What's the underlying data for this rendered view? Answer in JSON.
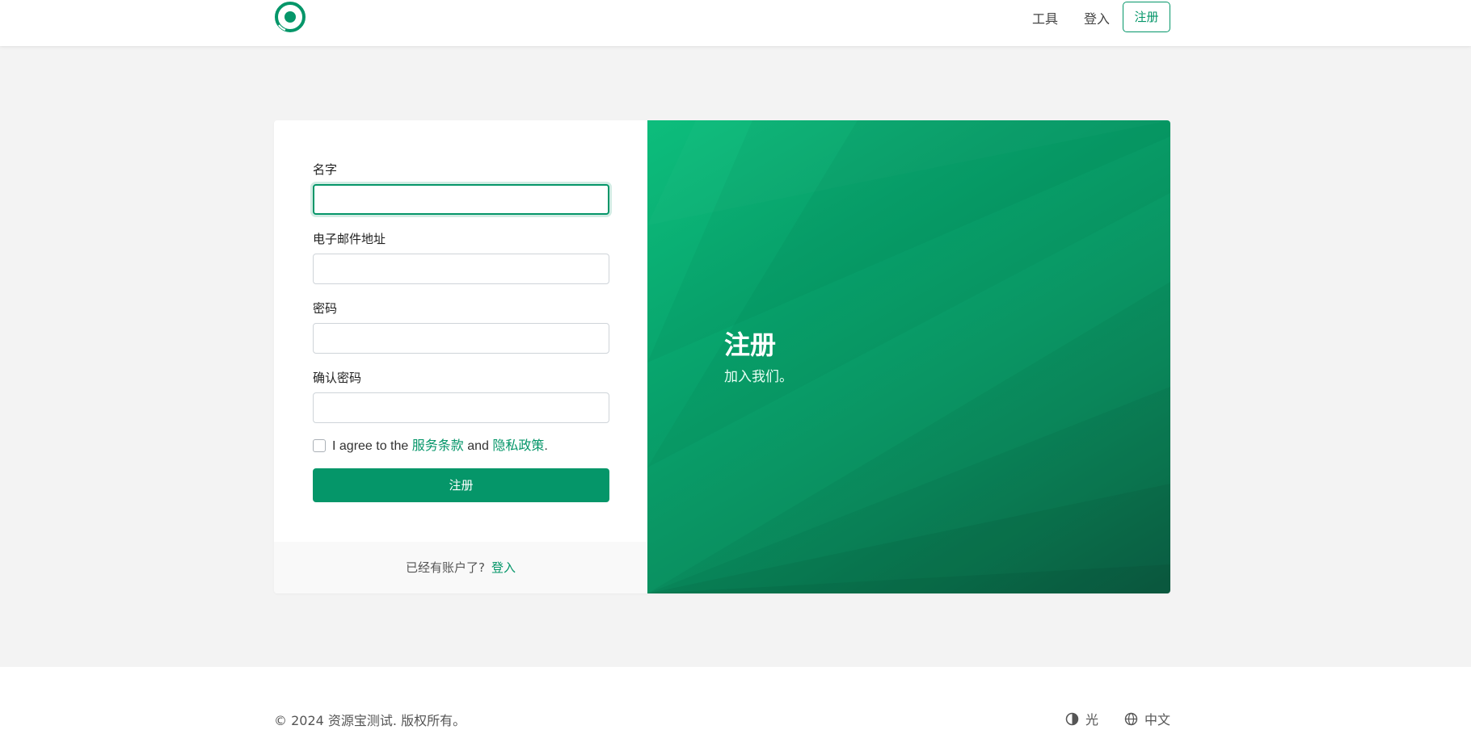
{
  "header": {
    "nav": {
      "tools": "工具",
      "login": "登入",
      "register": "注册"
    }
  },
  "form": {
    "fields": [
      {
        "label": "名字",
        "value": ""
      },
      {
        "label": "电子邮件地址",
        "value": ""
      },
      {
        "label": "密码",
        "value": ""
      },
      {
        "label": "确认密码",
        "value": ""
      }
    ],
    "agree": {
      "prefix": "I agree to the",
      "terms_link": "服务条款",
      "middle": "and",
      "privacy_link": "隐私政策",
      "suffix": "."
    },
    "submit": "注册",
    "footer": {
      "prompt": "已经有账户了?",
      "login_link": "登入"
    }
  },
  "hero": {
    "title": "注册",
    "subtitle": "加入我们。"
  },
  "footer": {
    "copyright": "© 2024 资源宝测试. 版权所有。",
    "theme": "光",
    "language": "中文"
  },
  "colors": {
    "brand": "#059669",
    "hero_light": "#0dbd7c",
    "hero_dark": "#0e6b4c"
  },
  "icons": {
    "logo": "ring-logo-icon",
    "theme": "contrast-icon",
    "language": "globe-icon"
  }
}
